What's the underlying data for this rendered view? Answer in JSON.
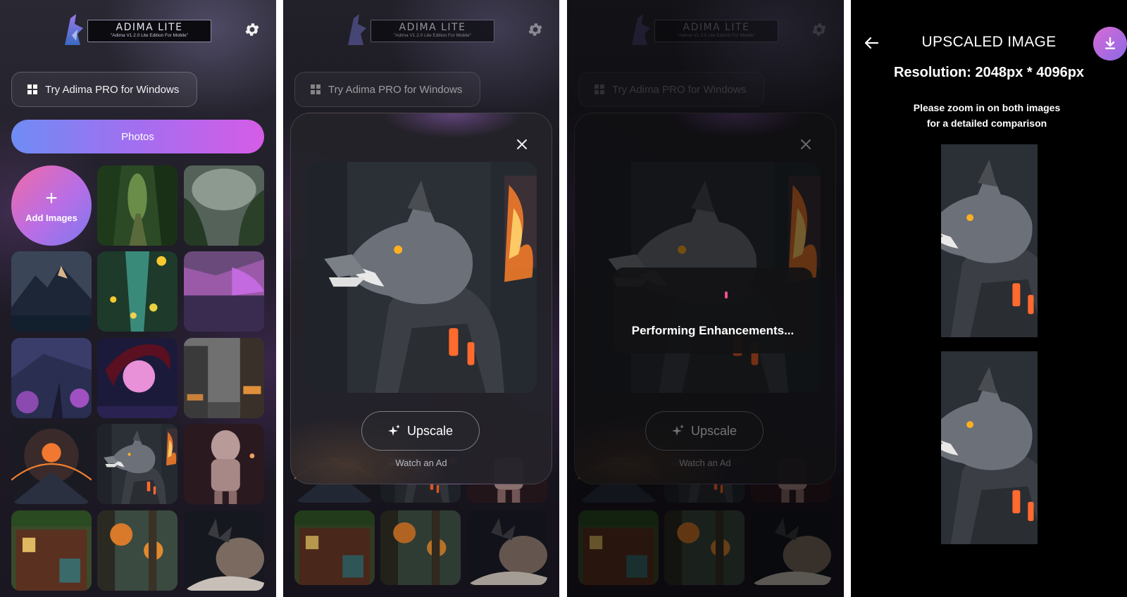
{
  "header": {
    "logo_title": "ADIMA LITE",
    "logo_subtitle": "\"Adima V1.2.0 Lite Edition For Mobile\"",
    "settings_icon": "gear-icon"
  },
  "pro_button": {
    "label": "Try Adima PRO for Windows",
    "icon": "windows-icon"
  },
  "photos_button": {
    "label": "Photos"
  },
  "add_images": {
    "plus": "+",
    "label": "Add Images"
  },
  "gallery": [
    {
      "name": "jungle-path"
    },
    {
      "name": "misty-jungle"
    },
    {
      "name": "mountain-peaks"
    },
    {
      "name": "glowing-flowers"
    },
    {
      "name": "purple-forest-lake"
    },
    {
      "name": "purple-valley"
    },
    {
      "name": "pink-moon-tree"
    },
    {
      "name": "misty-street"
    },
    {
      "name": "fiery-planet-mountain"
    },
    {
      "name": "cyber-wolf"
    },
    {
      "name": "astronaut"
    },
    {
      "name": "jungle-house"
    },
    {
      "name": "autumn-forest"
    },
    {
      "name": "storm-ship"
    }
  ],
  "upscale_dialog": {
    "close_icon": "close-icon",
    "upscale_label": "Upscale",
    "upscale_icon": "sparkle-icon",
    "watch_ad": "Watch an Ad",
    "loading_text": "Performing Enhancements...",
    "loading_color": "#ee4f94"
  },
  "result_screen": {
    "title": "UPSCALED IMAGE",
    "resolution": "Resolution: 2048px * 4096px",
    "hint_line1": "Please zoom in on both images",
    "hint_line2": "for a detailed comparison",
    "back_icon": "arrow-left-icon",
    "download_icon": "download-icon"
  },
  "colors": {
    "photos_gradient_start": "#6f8cf4",
    "photos_gradient_end": "#d65ce6",
    "add_images_gradient_start": "#f06aa6",
    "add_images_gradient_end": "#7d78ee",
    "background": "#1e1c26"
  }
}
